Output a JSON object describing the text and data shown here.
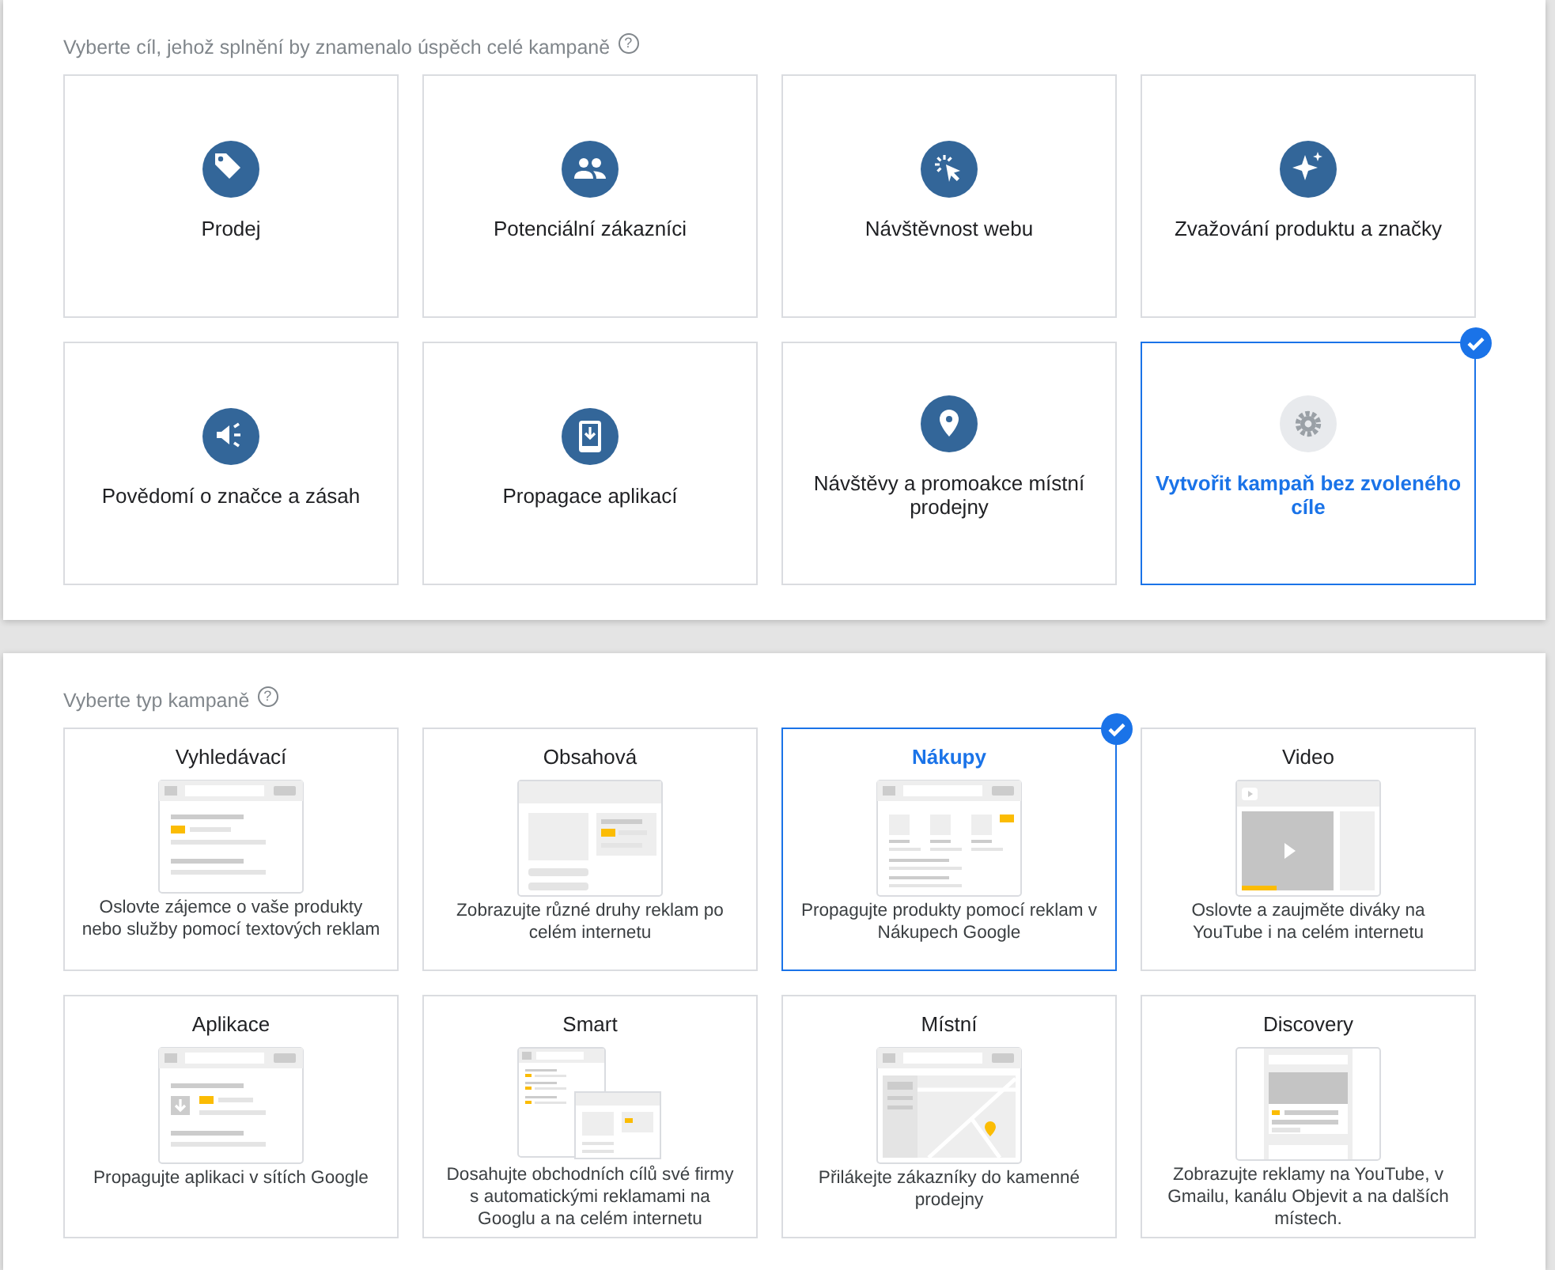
{
  "goal_section": {
    "title": "Vyberte cíl, jehož splnění by znamenalo úspěch celé kampaně",
    "help": "?"
  },
  "goals": [
    {
      "kind": "sales",
      "label": "Prodej",
      "selected": false
    },
    {
      "kind": "leads",
      "label": "Potenciální zákazníci",
      "selected": false
    },
    {
      "kind": "traffic",
      "label": "Návštěvnost webu",
      "selected": false
    },
    {
      "kind": "consideration",
      "label": "Zvažování produktu a značky",
      "selected": false
    },
    {
      "kind": "awareness",
      "label": "Povědomí o značce a zásah",
      "selected": false
    },
    {
      "kind": "app",
      "label": "Propagace aplikací",
      "selected": false
    },
    {
      "kind": "local",
      "label": "Návštěvy a promoakce místní prodejny",
      "selected": false
    },
    {
      "kind": "none",
      "label": "Vytvořit kampaň bez zvoleného cíle",
      "selected": true
    }
  ],
  "type_section": {
    "title": "Vyberte typ kampaně",
    "help": "?"
  },
  "campaign_types": [
    {
      "kind": "search",
      "title": "Vyhledávací",
      "description": "Oslovte zájemce o vaše produkty nebo služby pomocí textových reklam",
      "selected": false
    },
    {
      "kind": "display",
      "title": "Obsahová",
      "description": "Zobrazujte různé druhy reklam po celém internetu",
      "selected": false
    },
    {
      "kind": "shopping",
      "title": "Nákupy",
      "description": "Propagujte produkty pomocí reklam v Nákupech Google",
      "selected": true
    },
    {
      "kind": "video",
      "title": "Video",
      "description": "Oslovte a zaujměte diváky na YouTube i na celém internetu",
      "selected": false
    },
    {
      "kind": "app",
      "title": "Aplikace",
      "description": "Propagujte aplikaci v sítích Google",
      "selected": false
    },
    {
      "kind": "smart",
      "title": "Smart",
      "description": "Dosahujte obchodních cílů své firmy s automatickými reklamami na Googlu a na celém internetu",
      "selected": false
    },
    {
      "kind": "local",
      "title": "Místní",
      "description": "Přilákejte zákazníky do kamenné prodejny",
      "selected": false
    },
    {
      "kind": "discovery",
      "title": "Discovery",
      "description": "Zobrazujte reklamy na YouTube, v Gmailu, kanálu Objevit a na dalších místech.",
      "selected": false
    }
  ]
}
